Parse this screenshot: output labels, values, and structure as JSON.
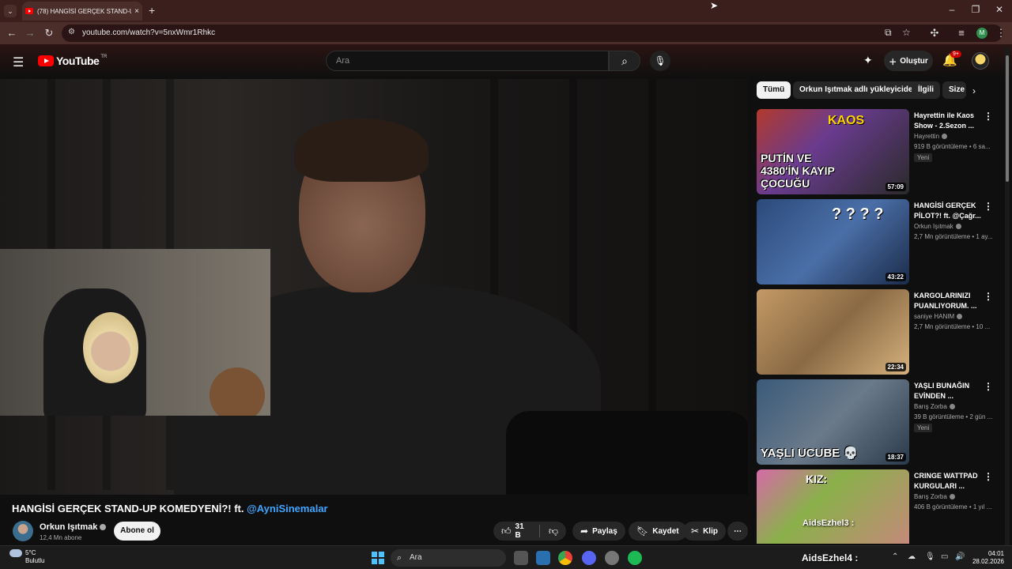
{
  "browser": {
    "tab_title": "(78) HANGİSİ GERÇEK STAND-U",
    "tab_close": "×",
    "new_tab": "+",
    "url": "youtube.com/watch?v=5nxWmr1Rhkc",
    "profile_initial": "M"
  },
  "youtube": {
    "logo_text": "YouTube",
    "region": "TR",
    "search_placeholder": "Ara",
    "create_label": "Oluştur",
    "notif_count": "9+"
  },
  "video": {
    "title_prefix": "HANGİSİ GERÇEK STAND-UP KOMEDYENİ?! ft. ",
    "title_link": "@AyniSinemalar",
    "channel": "Orkun Işıtmak",
    "subscribers": "12,4 Mn abone",
    "subscribe_label": "Abone ol",
    "likes": "31 B",
    "share_label": "Paylaş",
    "save_label": "Kaydet",
    "clip_label": "Klip"
  },
  "chips": [
    "Tümü",
    "Orkun Işıtmak adlı yükleyiciden",
    "İlgili",
    "Size"
  ],
  "recommendations": [
    {
      "title": "Hayrettin ile Kaos Show - 2.Sezon ...",
      "channel": "Hayrettin",
      "meta": "919 B görüntüleme • 6 sa...",
      "badge": "Yeni",
      "duration": "57:09",
      "thumb_text": "PUTİN VE 4380'İN KAYIP ÇOCUĞU",
      "thumb_top": "KAOS"
    },
    {
      "title": "HANGİSİ GERÇEK PİLOT?! ft. @Çağr...",
      "channel": "Orkun Işıtmak",
      "meta": "2,7 Mn görüntüleme • 1 ay...",
      "badge": "",
      "duration": "43:22",
      "thumb_text": "",
      "thumb_top": "? ? ? ?"
    },
    {
      "title": "KARGOLARINIZI PUANLIYORUM. ...",
      "channel": "saniye HANIM",
      "meta": "2,7 Mn görüntüleme • 10 ...",
      "badge": "",
      "duration": "22:34",
      "thumb_text": "",
      "thumb_top": ""
    },
    {
      "title": "YAŞLI BUNAĞIN EVİNDEN ...",
      "channel": "Barış Zorba",
      "meta": "39 B görüntüleme • 2 gün ...",
      "badge": "Yeni",
      "duration": "18:37",
      "thumb_text": "YAŞLI UCUBE 💀",
      "thumb_top": ""
    },
    {
      "title": "CRINGE WATTPAD KURGULARI ...",
      "channel": "Barış Zorba",
      "meta": "406 B görüntüleme • 1 yıl ...",
      "badge": "",
      "duration": "",
      "thumb_text": "AidsEzhel3 :",
      "thumb_top": "KIZ:"
    }
  ],
  "taskbar": {
    "temp": "5°C",
    "weather": "Bulutlu",
    "search": "Ara",
    "overlay_name": "AidsEzhel4 :",
    "time": "04:01",
    "date": "28.02.2026"
  },
  "colors": {
    "accent_red": "#ff0000",
    "link_blue": "#3ea6ff",
    "browser_frame": "#3a1f1d"
  }
}
